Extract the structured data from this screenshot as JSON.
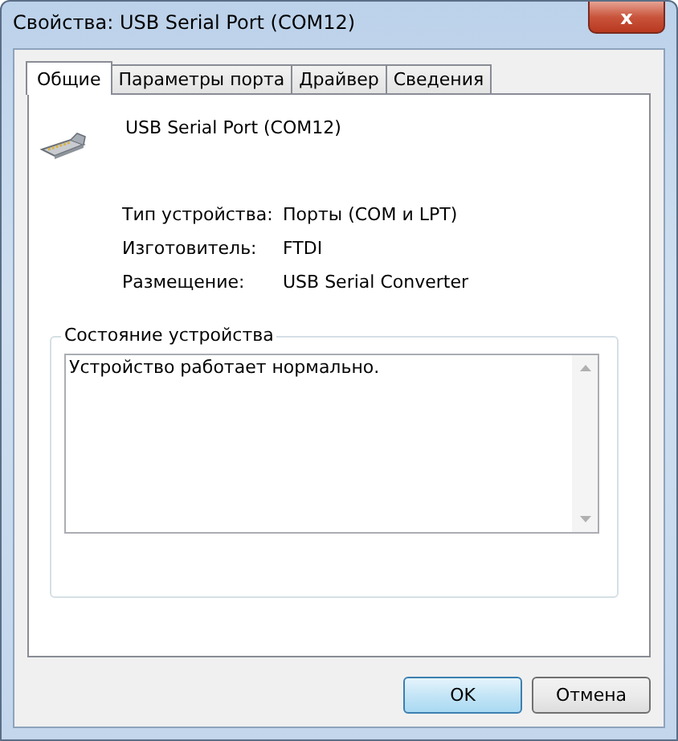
{
  "window": {
    "title": "Свойства: USB Serial Port (COM12)",
    "close": "x"
  },
  "tabs": [
    {
      "label": "Общие",
      "selected": true
    },
    {
      "label": "Параметры порта",
      "selected": false
    },
    {
      "label": "Драйвер",
      "selected": false
    },
    {
      "label": "Сведения",
      "selected": false
    }
  ],
  "device": {
    "name": "USB Serial Port (COM12)"
  },
  "properties": [
    {
      "label": "Тип устройства:",
      "value": "Порты (COM и LPT)"
    },
    {
      "label": "Изготовитель:",
      "value": "FTDI"
    },
    {
      "label": "Размещение:",
      "value": "USB Serial Converter"
    }
  ],
  "status": {
    "title": "Состояние устройства",
    "text": "Устройство работает нормально."
  },
  "buttons": [
    {
      "label": "OK",
      "default": true
    },
    {
      "label": "Отмена",
      "default": false
    }
  ]
}
